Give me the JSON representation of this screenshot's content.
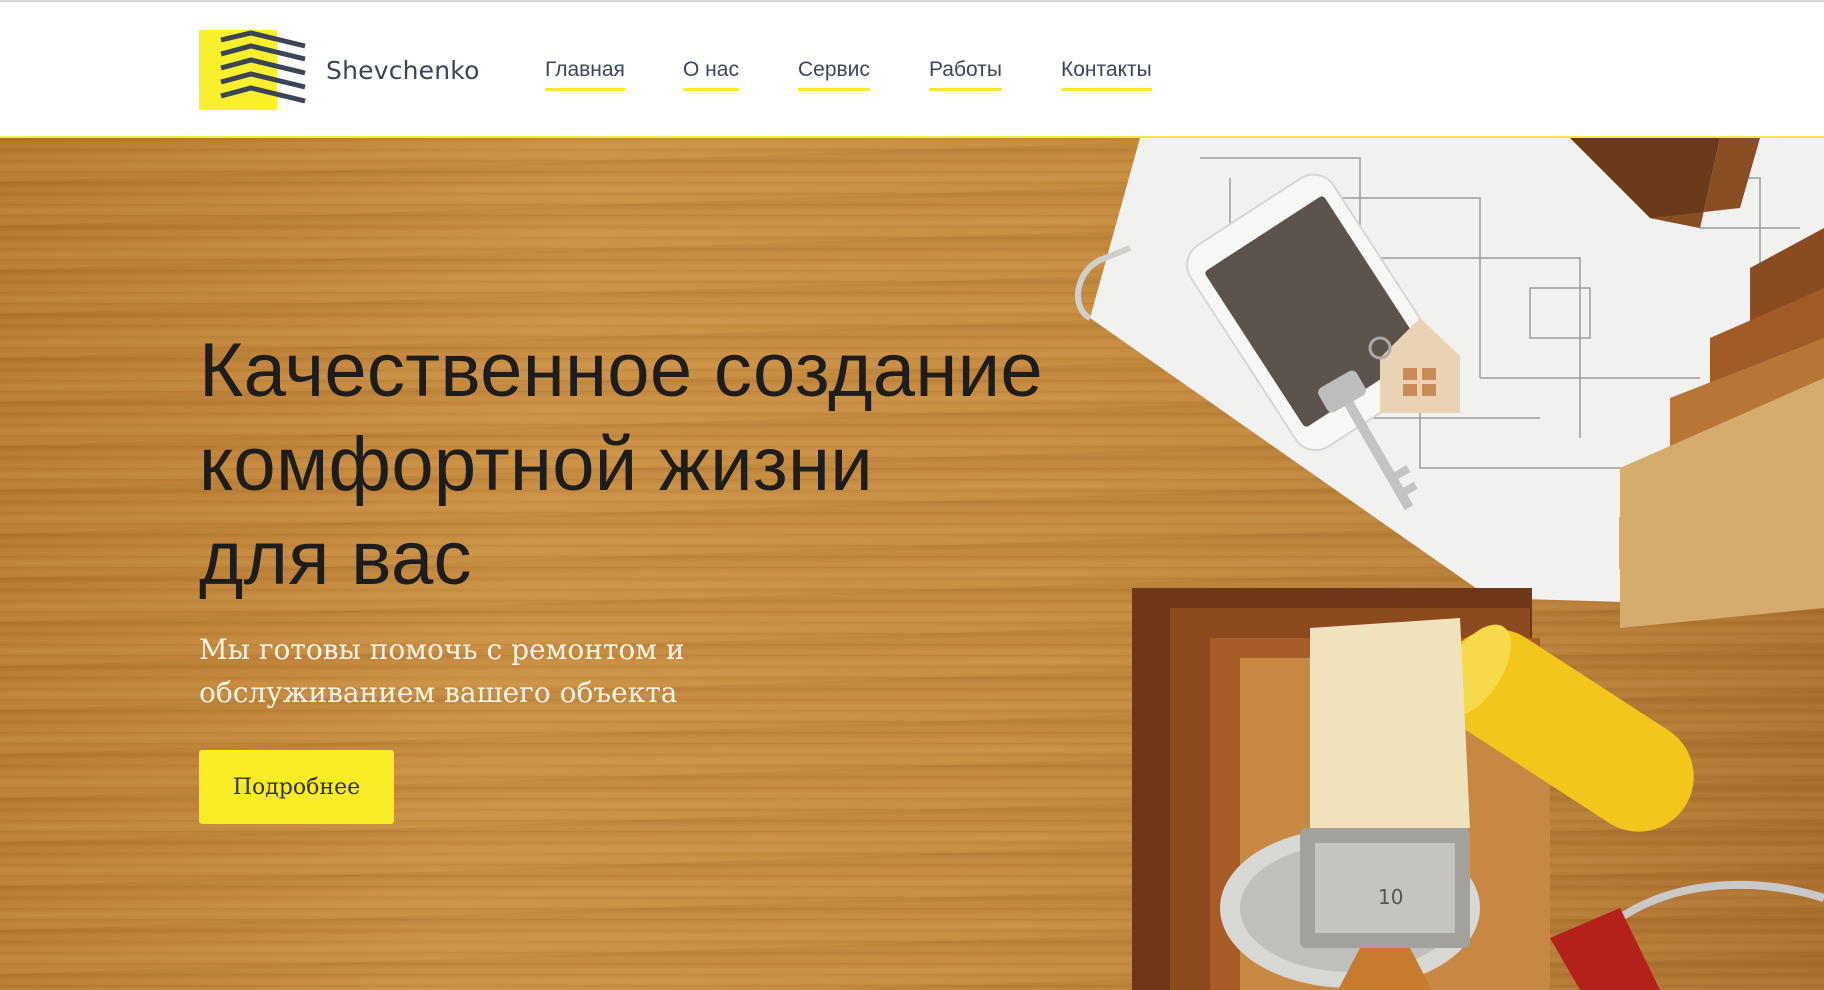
{
  "header": {
    "brand": "Shevchenko",
    "nav": [
      {
        "label": "Главная"
      },
      {
        "label": "О нас"
      },
      {
        "label": "Сервис"
      },
      {
        "label": "Работы"
      },
      {
        "label": "Контакты"
      }
    ]
  },
  "hero": {
    "title_lines": [
      "Качественное создание",
      "комфортной жизни",
      "для вас"
    ],
    "subtitle_lines": [
      "Мы готовы помочь с ремонтом и",
      "обслуживанием вашего объекта"
    ],
    "cta_label": "Подробнее",
    "brush_label": "10"
  },
  "colors": {
    "accent": "#f8ec27",
    "nav_text": "#3c4658",
    "title_text": "#1d1d1d",
    "wood": "#c98e42"
  },
  "icons": [
    "logo-chevrons-icon"
  ]
}
